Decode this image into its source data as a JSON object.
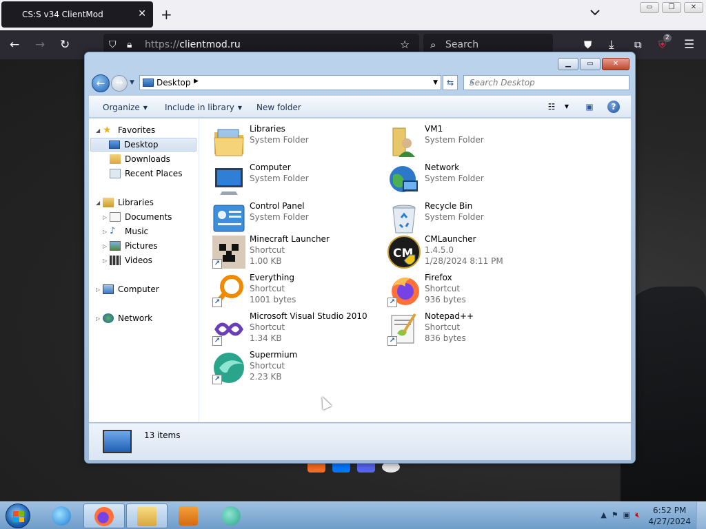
{
  "browser": {
    "tab_title": "CS:S v34 ClientMod",
    "tab_close": "✕",
    "new_tab": "+",
    "url_scheme": "https://",
    "url_host": "clientmod.ru",
    "search_placeholder": "Search",
    "extension_badge": "2"
  },
  "explorer": {
    "address_crumb": "Desktop",
    "search_placeholder": "Search Desktop",
    "toolbar": {
      "organize": "Organize",
      "include_in_library": "Include in library",
      "new_folder": "New folder"
    },
    "nav": {
      "favorites": "Favorites",
      "desktop": "Desktop",
      "downloads": "Downloads",
      "recent_places": "Recent Places",
      "libraries": "Libraries",
      "documents": "Documents",
      "music": "Music",
      "pictures": "Pictures",
      "videos": "Videos",
      "computer": "Computer",
      "network": "Network"
    },
    "items": [
      {
        "name": "Libraries",
        "type": "System Folder",
        "size": ""
      },
      {
        "name": "VM1",
        "type": "System Folder",
        "size": ""
      },
      {
        "name": "Computer",
        "type": "System Folder",
        "size": ""
      },
      {
        "name": "Network",
        "type": "System Folder",
        "size": ""
      },
      {
        "name": "Control Panel",
        "type": "System Folder",
        "size": ""
      },
      {
        "name": "Recycle Bin",
        "type": "System Folder",
        "size": ""
      },
      {
        "name": "Minecraft Launcher",
        "type": "Shortcut",
        "size": "1.00 KB"
      },
      {
        "name": "CMLauncher",
        "type": "1.4.5.0",
        "size": "1/28/2024 8:11 PM"
      },
      {
        "name": "Everything",
        "type": "Shortcut",
        "size": "1001 bytes"
      },
      {
        "name": "Firefox",
        "type": "Shortcut",
        "size": "936 bytes"
      },
      {
        "name": "Microsoft Visual Studio 2010",
        "type": "Shortcut",
        "size": "1.34 KB"
      },
      {
        "name": "Notepad++",
        "type": "Shortcut",
        "size": "836 bytes"
      },
      {
        "name": "Supermium",
        "type": "Shortcut",
        "size": "2.23 KB"
      }
    ],
    "status": "13 items"
  },
  "taskbar": {
    "time": "6:52 PM",
    "date": "4/27/2024"
  },
  "colors": {
    "browser_dark": "#2b2a33",
    "accent_blue": "#1f63b5",
    "taskbar": "#8fb4da"
  }
}
